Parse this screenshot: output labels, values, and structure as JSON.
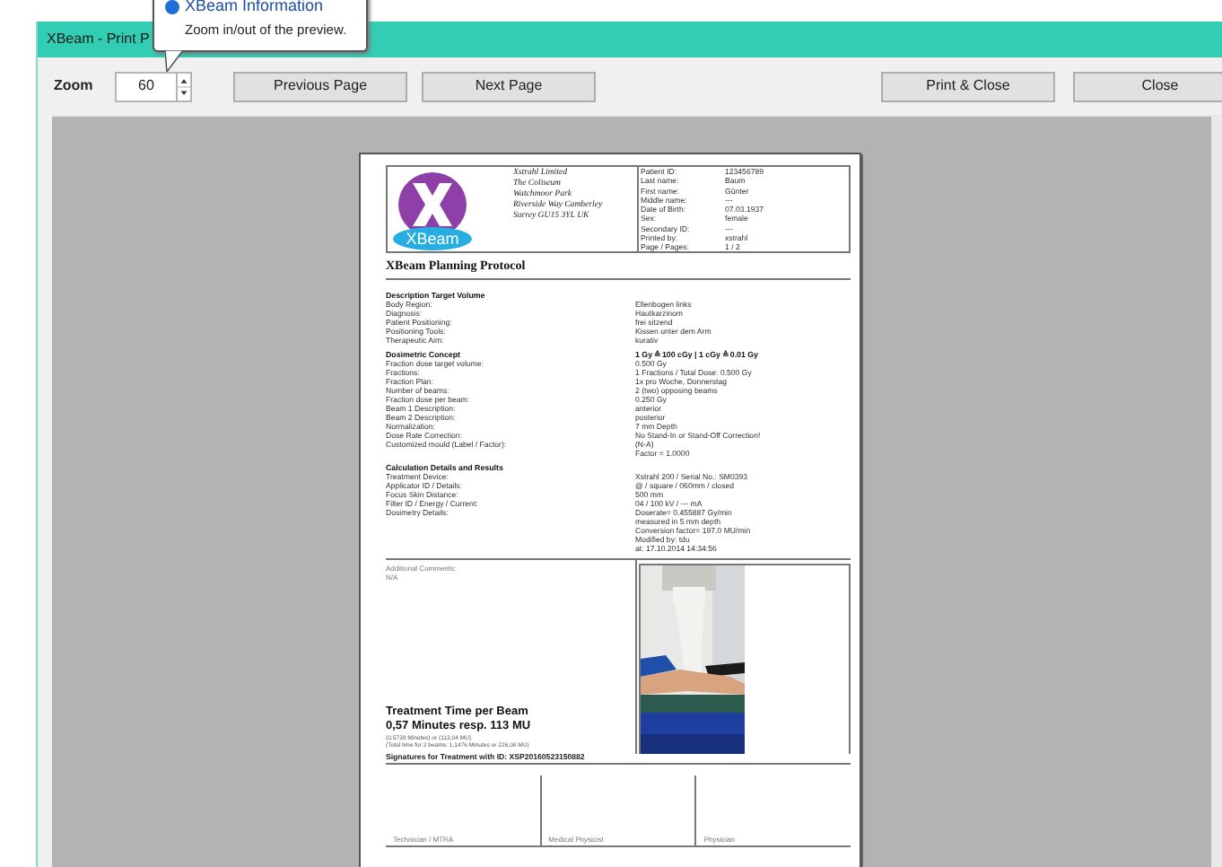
{
  "window": {
    "title": "XBeam - Print P"
  },
  "tooltip": {
    "title": "XBeam Information",
    "text": "Zoom in/out of the preview."
  },
  "toolbar": {
    "zoom_label": "Zoom",
    "zoom_value": "60",
    "buttons": [
      {
        "label": "Previous Page",
        "kind": "nav"
      },
      {
        "label": "Next Page",
        "kind": "nav"
      },
      {
        "label": "Print & Close",
        "kind": "action"
      },
      {
        "label": "Close",
        "kind": "action"
      }
    ]
  },
  "document": {
    "logo_text": "XBeam",
    "address": [
      "Xstrahl Limited",
      "The Coliseum",
      "Watchmoor Park",
      "Riverside Way Camberley",
      "Surrey GU15 3YL UK"
    ],
    "patient": [
      {
        "label": "Patient ID:",
        "value": "123456789"
      },
      {
        "label": "Last name:",
        "value": "Baum"
      },
      {
        "label": "First name:",
        "value": "Günter"
      },
      {
        "label": "Middle name:",
        "value": "---"
      },
      {
        "label": "Date of Birth:",
        "value": "07.03.1937"
      },
      {
        "label": "Sex:",
        "value": "female"
      },
      {
        "label": "Secondary ID:",
        "value": "---"
      },
      {
        "label": "Printed by:",
        "value": "xstrahl"
      },
      {
        "label": "Page / Pages:",
        "value": "1 / 2"
      }
    ],
    "title": "XBeam Planning Protocol",
    "sections": [
      {
        "heading": "Description Target Volume",
        "rows": [
          {
            "label": "Body Region:",
            "lines": [
              "Ellenbogen links"
            ]
          },
          {
            "label": "Diagnosis:",
            "lines": [
              "Hautkarzinom"
            ]
          },
          {
            "label": "Patient Positioning:",
            "lines": [
              "frei sitzend"
            ]
          },
          {
            "label": "Positioning Tools:",
            "lines": [
              "Kissen unter dem Arm"
            ]
          },
          {
            "label": "Therapeutic Aim:",
            "lines": [
              "kurativ"
            ]
          }
        ]
      },
      {
        "heading": "Dosimetric Concept",
        "heading_value": "1 Gy ≙ 100 cGy  |  1 cGy ≙ 0.01 Gy",
        "rows": [
          {
            "label": "Fraction dose target volume:",
            "lines": [
              "0.500 Gy"
            ]
          },
          {
            "label": "Fractions:",
            "lines": [
              "1 Fractions / Total Dose: 0.500 Gy"
            ]
          },
          {
            "label": "Fraction Plan:",
            "lines": [
              "1x pro Woche, Donnerstag"
            ]
          },
          {
            "label": "Number of beams:",
            "lines": [
              "2 (two) opposing beams"
            ]
          },
          {
            "label": "Fraction dose per beam:",
            "lines": [
              "0.250 Gy"
            ]
          },
          {
            "label": "Beam 1 Description:",
            "lines": [
              "anterior"
            ]
          },
          {
            "label": "Beam 2 Description:",
            "lines": [
              "posterior"
            ]
          },
          {
            "label": "Normalization:",
            "lines": [
              "7 mm Depth"
            ]
          },
          {
            "label": "Dose Rate Correction:",
            "lines": [
              "No Stand-In or Stand-Off Correction!"
            ]
          },
          {
            "label": "Customized mould (Label / Factor):",
            "lines": [
              "(N-A)",
              "Factor = 1.0000"
            ]
          }
        ]
      },
      {
        "heading": "Calculation Details and Results",
        "rows": [
          {
            "label": "Treatment Device:",
            "lines": [
              "Xstrahl 200 / Serial No.: SM0393"
            ]
          },
          {
            "label": "Applicator ID / Details:",
            "lines": [
              "@ / square / 060mm / closed"
            ]
          },
          {
            "label": "Focus Skin Distance:",
            "lines": [
              "500 mm"
            ]
          },
          {
            "label": "Filter ID / Energy / Current:",
            "lines": [
              "04 / 100 kV / --- mA"
            ]
          },
          {
            "label": "Dosimetry Details:",
            "lines": [
              "Doserate= 0.455887 Gy/min",
              "measured in 5 mm depth",
              "Conversion factor= 197.0 MU/min",
              "Modified by: tdu",
              "at: 17.10.2014 14:34:56"
            ]
          }
        ]
      }
    ],
    "comments_label": "Additional Comments:",
    "comments": "N/A",
    "treatment_title": "Treatment Time per Beam",
    "treatment_value": "0,57 Minutes resp. 113 MU",
    "treatment_notes": [
      "(0,5738 Minutes) or (113,04 MU)",
      "(Total time for 2 beams: 1,1476 Minutes or 226,08 MU)"
    ],
    "signature_heading": "Signatures for Treatment with ID: XSP20160523150882",
    "signatures": [
      "Technician / MTRA",
      "Medical Physicist",
      "Physician"
    ]
  }
}
